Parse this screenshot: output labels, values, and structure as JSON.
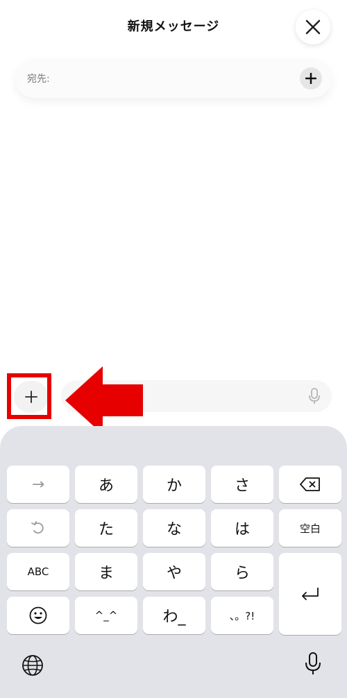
{
  "header": {
    "title": "新規メッセージ"
  },
  "to_field": {
    "label": "宛先:"
  },
  "keyboard": {
    "rows": [
      [
        "→",
        "あ",
        "か",
        "さ",
        "⌫"
      ],
      [
        "↺",
        "た",
        "な",
        "は",
        "空白"
      ],
      [
        "ABC",
        "ま",
        "や",
        "ら",
        "⏎"
      ],
      [
        "☺",
        "^_^",
        "わ_",
        "、。?!"
      ]
    ],
    "labels": {
      "next": "→",
      "a": "あ",
      "ka": "か",
      "sa": "さ",
      "undo": "↺",
      "ta": "た",
      "na": "な",
      "ha": "は",
      "space": "空白",
      "abc": "ABC",
      "ma": "ま",
      "ya": "や",
      "ra": "ら",
      "kaomoji": "^_^",
      "wa": "わ_",
      "punct": "、。?!"
    }
  },
  "icons": {
    "close": "close-icon",
    "add": "plus-icon",
    "mic": "microphone-icon",
    "globe": "globe-icon",
    "backspace": "backspace-icon",
    "return": "return-icon",
    "emoji": "emoji-icon"
  },
  "colors": {
    "highlight": "#e60000",
    "keyboard_bg": "#e2e3e8"
  }
}
